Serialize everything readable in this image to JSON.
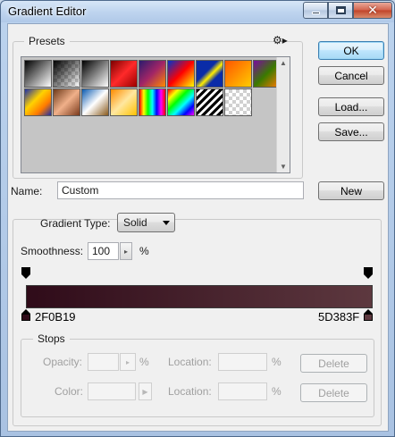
{
  "window": {
    "title": "Gradient Editor"
  },
  "presets": {
    "label": "Presets",
    "menu_icon": "gear-icon",
    "swatches": [
      "linear-gradient(135deg, #000 0%, #fff 100%)",
      "linear-gradient(135deg, #000 0%, rgba(0,0,0,0) 100%)",
      "linear-gradient(135deg, #000 0%, #fff 100%)",
      "linear-gradient(135deg, #7a0000 0%, #ff2a2a 50%, #9a0000 100%)",
      "linear-gradient(135deg, #2c1b6e 0%, #a12566 50%, #ff8a00 100%)",
      "linear-gradient(135deg, #0033cc 0%, #ff0000 50%, #ffff00 100%)",
      "linear-gradient(135deg, #0a2ca8 0%, #0a2ca8 40%, #ffee00 55%, #0a2ca8 70%)",
      "linear-gradient(135deg, #ff5500 0%, #ffcc00 100%)",
      "linear-gradient(135deg, #7a0aa0 0%, #3a7a00 50%, #ff7a00 100%)",
      "linear-gradient(135deg, #1c2fa8 0%, #ffd200 40%, #ff7a00 70%, #1c2fa8 100%)",
      "linear-gradient(135deg, #6d3a1a 0%, #f0b08a 50%, #7a3a1c 100%)",
      "linear-gradient(135deg, #0a5ab0 0%, #ffffff 50%, #8a5a1c 100%)",
      "linear-gradient(135deg, #ff8a00 0%, #ffe7a0 50%, #ffc100 100%)",
      "linear-gradient(90deg, #ff0000, #ffff00, #00ff00, #00ffff, #0000ff, #ff00ff, #ff0000)",
      "linear-gradient(135deg, #ff0000, #ffff00, #00ff00, #00ffff, #0000ff, #ff00ff)",
      "repeating-linear-gradient(135deg, #000 0px, #000 3px, #fff 3px, #fff 6px)",
      "linear-gradient(135deg, rgba(0,0,0,0) 0%, rgba(0,0,0,0) 100%)"
    ]
  },
  "buttons": {
    "ok": "OK",
    "cancel": "Cancel",
    "load": "Load...",
    "save": "Save...",
    "new": "New"
  },
  "name_field": {
    "label": "Name:",
    "value": "Custom"
  },
  "gradient": {
    "type_label": "Gradient Type:",
    "type_value": "Solid",
    "smoothness_label": "Smoothness:",
    "smoothness_value": "100",
    "smoothness_unit": "%",
    "left_color": "#2F0B19",
    "right_color": "#5D383F",
    "left_hex": "2F0B19",
    "right_hex": "5D383F"
  },
  "stops": {
    "label": "Stops",
    "opacity_label": "Opacity:",
    "opacity_unit": "%",
    "color_label": "Color:",
    "location_label": "Location:",
    "location_unit": "%",
    "delete_label": "Delete"
  }
}
